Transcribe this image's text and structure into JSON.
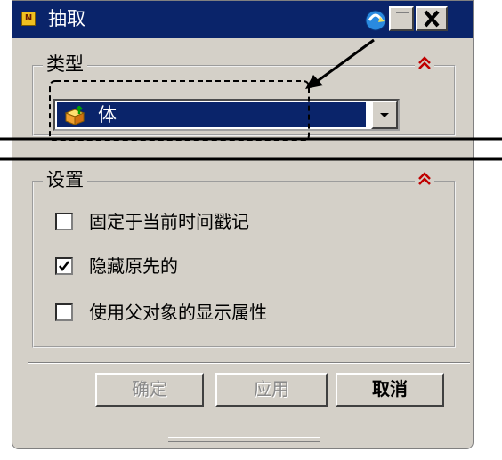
{
  "window": {
    "title": "抽取"
  },
  "type_group": {
    "title": "类型",
    "selected": "体"
  },
  "settings_group": {
    "title": "设置",
    "options": [
      {
        "label": "固定于当前时间戳记",
        "checked": false
      },
      {
        "label": "隐藏原先的",
        "checked": true
      },
      {
        "label": "使用父对象的显示属性",
        "checked": false
      }
    ]
  },
  "buttons": {
    "ok": "确定",
    "apply": "应用",
    "cancel": "取消"
  },
  "icons": [
    "app-logo-icon",
    "reset-icon",
    "minimize-icon",
    "close-icon",
    "collapse-icon",
    "body-icon",
    "dropdown-arrow-icon",
    "checkmark-icon"
  ],
  "colors": {
    "titlebar": "#0a246a",
    "dialog": "#d4d0c8",
    "collapse": "#c00000"
  }
}
